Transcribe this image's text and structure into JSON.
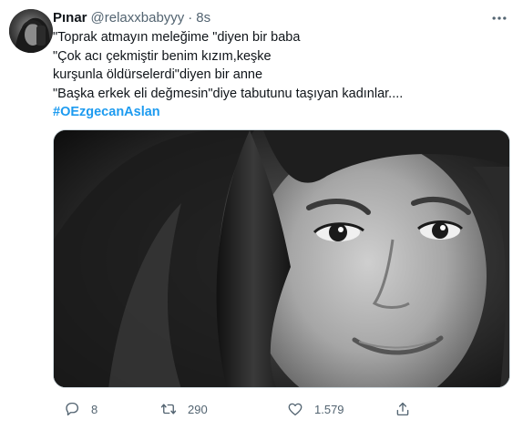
{
  "tweet": {
    "display_name": "Pınar",
    "handle": "@relaxxbabyyy",
    "separator": "·",
    "time": "8s",
    "lines": [
      "\"Toprak atmayın meleğime \"diyen bir baba",
      "\"Çok acı çekmiştir benim kızım,keşke",
      "kurşunla öldürselerdi\"diyen bir anne",
      "\"Başka erkek eli değmesin\"diye tabutunu taşıyan kadınlar...."
    ],
    "hashtag": "#OEzgecanAslan",
    "stats": {
      "replies": "8",
      "retweets": "290",
      "likes": "1.579"
    }
  },
  "icons": {
    "more": "more-horizontal-icon",
    "reply": "reply-icon",
    "retweet": "retweet-icon",
    "like": "heart-icon",
    "share": "share-icon"
  },
  "colors": {
    "text": "#0f1419",
    "secondary": "#536471",
    "link": "#1d9bf0",
    "border": "#cfd9de"
  }
}
